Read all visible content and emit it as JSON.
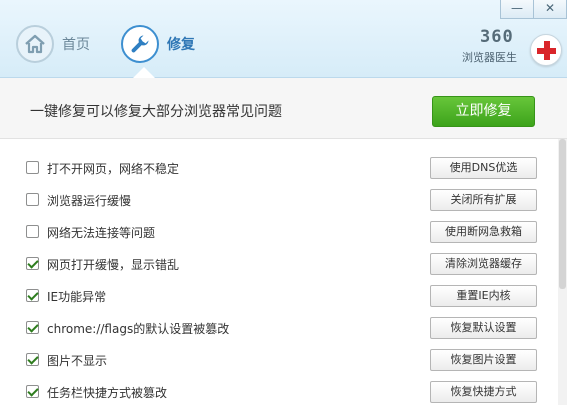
{
  "window": {
    "minimize_symbol": "—",
    "close_symbol": "✕"
  },
  "nav": {
    "home": {
      "label": "首页",
      "icon": "home-icon"
    },
    "repair": {
      "label": "修复",
      "icon": "wrench-icon"
    }
  },
  "brand": {
    "number": "360",
    "name": "浏览器医生",
    "accent_color": "#d9252a"
  },
  "banner": {
    "text": "一键修复可以修复大部分浏览器常见问题",
    "button_label": "立即修复",
    "button_color": "#3da31b"
  },
  "items": [
    {
      "label": "打不开网页，网络不稳定",
      "checked": false,
      "action": "使用DNS优选"
    },
    {
      "label": "浏览器运行缓慢",
      "checked": false,
      "action": "关闭所有扩展"
    },
    {
      "label": "网络无法连接等问题",
      "checked": false,
      "action": "使用断网急救箱"
    },
    {
      "label": "网页打开缓慢，显示错乱",
      "checked": true,
      "action": "清除浏览器缓存"
    },
    {
      "label": "IE功能异常",
      "checked": true,
      "action": "重置IE内核"
    },
    {
      "label": "chrome://flags的默认设置被篡改",
      "checked": true,
      "action": "恢复默认设置"
    },
    {
      "label": "图片不显示",
      "checked": true,
      "action": "恢复图片设置"
    },
    {
      "label": "任务栏快捷方式被篡改",
      "checked": true,
      "action": "恢复快捷方式"
    }
  ]
}
